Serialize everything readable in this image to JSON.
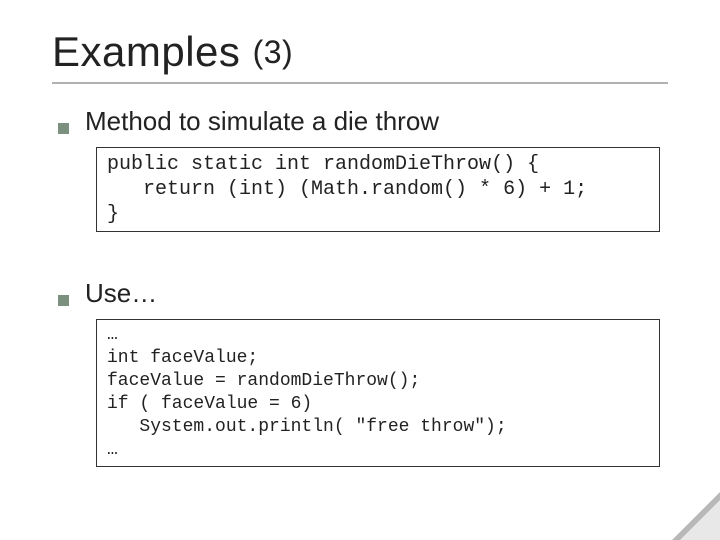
{
  "title_main": "Examples",
  "title_paren": "(3)",
  "item1_label": "Method to simulate a die throw",
  "code1": "public static int randomDieThrow() {\n   return (int) (Math.random() * 6) + 1;\n}",
  "item2_label": "Use…",
  "code2": "…\nint faceValue;\nfaceValue = randomDieThrow();\nif ( faceValue = 6)\n   System.out.println( \"free throw\");\n…"
}
